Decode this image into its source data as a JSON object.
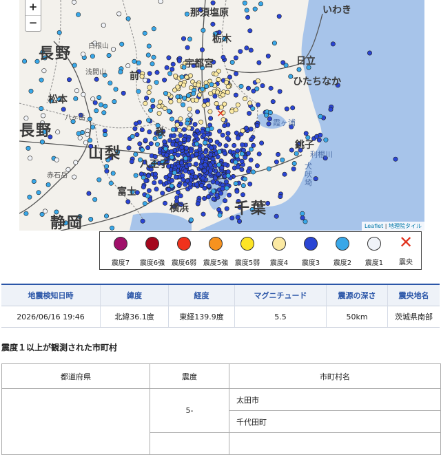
{
  "map": {
    "zoom_in": "+",
    "zoom_out": "−",
    "labels": {
      "gunma_nasu": "那須塩原",
      "utsunomiya": "宇都宮",
      "hitachi": "日立",
      "hitachinaka": "ひたちなか",
      "iwaki": "いわき",
      "nagano": "長野",
      "matsumoto": "松本",
      "yamanashi": "山梨",
      "hachioji": "八王子",
      "yokohama": "横浜",
      "chiba": "千葉",
      "shizuoka": "静岡",
      "fuji": "富士",
      "kasumigaura": "霞ヶ浦",
      "tone": "利根川",
      "choshi": "銚子",
      "shirane": "白根山",
      "asama": "浅間山",
      "yatsugatake": "八ヶ岳",
      "akaishi": "赤石岳",
      "inuboh": "犬吠埼",
      "mae": "前",
      "chichibu": "秩",
      "tochigi": "栃木"
    },
    "attribution_leaflet": "Leaflet",
    "attribution_sep": " | ",
    "attribution_gsi": "地理院タイル",
    "colors": {
      "land": "#f3f1ec",
      "sea": "#a7c4ea",
      "pref_border": "#8a8a8a",
      "rail": "#555555"
    }
  },
  "legend": [
    {
      "label": "震度7",
      "color": "#a0106a"
    },
    {
      "label": "震度6強",
      "color": "#a5071d"
    },
    {
      "label": "震度6弱",
      "color": "#f0321c"
    },
    {
      "label": "震度5強",
      "color": "#f7921f"
    },
    {
      "label": "震度5弱",
      "color": "#fde426"
    },
    {
      "label": "震度4",
      "color": "#fbe9a2"
    },
    {
      "label": "震度3",
      "color": "#2a45d4"
    },
    {
      "label": "震度2",
      "color": "#38a7e8"
    },
    {
      "label": "震度1",
      "color": "#f0f3f8"
    },
    {
      "label": "震央",
      "color": "#e0321e",
      "icon": "cross-icon"
    }
  ],
  "summary": {
    "headers": [
      "地震検知日時",
      "緯度",
      "経度",
      "マグニチュード",
      "震源の深さ",
      "震央地名"
    ],
    "row": [
      "2026/06/16 19:46",
      "北緯36.1度",
      "東経139.9度",
      "5.5",
      "50km",
      "茨城県南部"
    ]
  },
  "section_title": "震度１以上が観測された市町村",
  "municipalities": {
    "headers": [
      "都道府県",
      "震度",
      "市町村名"
    ],
    "group_intensity": "5-",
    "towns": [
      "太田市",
      "千代田町"
    ]
  }
}
